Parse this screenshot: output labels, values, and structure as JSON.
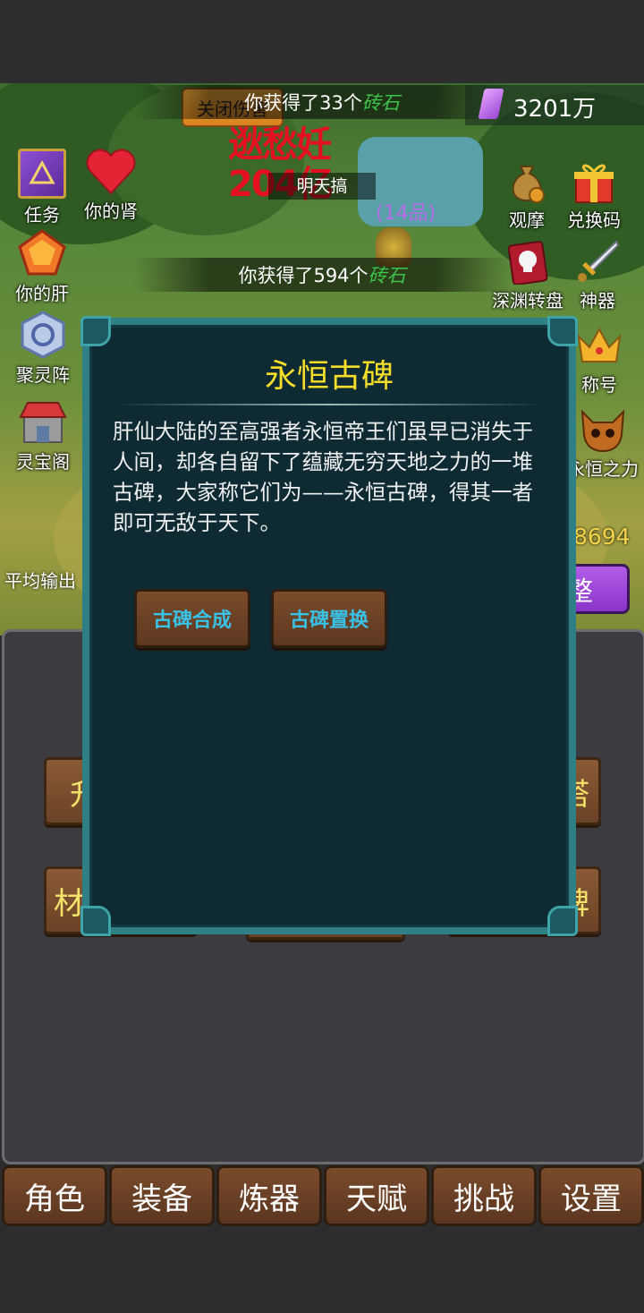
{
  "hud": {
    "close_damage_button": "关闭伤害",
    "crystal_amount": "3201万",
    "toast_top": {
      "prefix": "你获得了33个",
      "item": "砖石"
    },
    "toast_bottom": {
      "prefix": "你获得了594个",
      "item": "砖石"
    },
    "boss_name": "明天搞",
    "boss_grade_fragment": "(14品)",
    "damage_overlay": "逖愁妊 204亿",
    "combat_power_fragment": "攻 8694",
    "avg_output_label": "平均输出",
    "adjust_button_fragment": "调整"
  },
  "left_icons": [
    {
      "label": "任务",
      "icon": "book-icon"
    },
    {
      "label": "你的肾",
      "icon": "heart-icon"
    },
    {
      "label": "你的肝",
      "icon": "gem-icon"
    },
    {
      "label": "聚灵阵",
      "icon": "rune-stone-icon"
    },
    {
      "label": "灵宝阁",
      "icon": "shop-icon"
    }
  ],
  "right_icons": [
    {
      "label": "观摩",
      "icon": "money-bag-icon"
    },
    {
      "label": "兑换码",
      "icon": "gift-icon"
    },
    {
      "label": "深渊转盘",
      "icon": "skull-card-icon"
    },
    {
      "label": "神器",
      "icon": "sword-icon"
    },
    {
      "label": "称号",
      "icon": "crown-icon"
    },
    {
      "label": "永恒之力",
      "icon": "demon-skull-icon"
    }
  ],
  "menu_partial": {
    "row1_left": "升",
    "row1_right": "塔",
    "row2_left": "材",
    "row2_right": "碑"
  },
  "dialog": {
    "title": "永恒古碑",
    "description": "肝仙大陆的至高强者永恒帝王们虽早已消失于人间，却各自留下了蕴藏无穷天地之力的一堆古碑，大家称它们为——永恒古碑，得其一者即可无敌于天下。",
    "buttons": [
      "古碑合成",
      "古碑置换"
    ]
  },
  "bottom_nav": [
    "角色",
    "装备",
    "炼器",
    "天赋",
    "挑战",
    "设置"
  ],
  "colors": {
    "dialog_bg": "#0e2b33",
    "dialog_border": "#2f7f86",
    "title_yellow": "#f5dd2a",
    "button_text_blue": "#39c2e8",
    "wood": "#6a4226"
  }
}
